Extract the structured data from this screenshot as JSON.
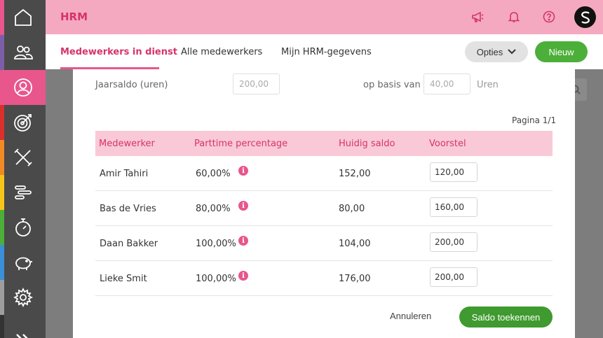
{
  "app": {
    "title": "HRM"
  },
  "tabs": [
    {
      "label": "Medewerkers in dienst",
      "active": true
    },
    {
      "label": "Alle medewerkers",
      "active": false
    },
    {
      "label": "Mijn HRM-gegevens",
      "active": false
    }
  ],
  "toolbar": {
    "opties_label": "Opties",
    "nieuw_label": "Nieuw"
  },
  "sidebar": {
    "items": [
      {
        "name": "home-icon",
        "stripe": "#e8568c"
      },
      {
        "name": "users-icon",
        "stripe": "#7b5ea7"
      },
      {
        "name": "user-icon",
        "stripe": "#e8568c",
        "active": true
      },
      {
        "name": "target-icon",
        "stripe": "#d9302c"
      },
      {
        "name": "tools-icon",
        "stripe": "#f08a24"
      },
      {
        "name": "planning-icon",
        "stripe": "#f5c518"
      },
      {
        "name": "stopwatch-icon",
        "stripe": "#4caf39"
      },
      {
        "name": "piggy-bank-icon",
        "stripe": "#3b8fd9"
      },
      {
        "name": "gear-icon",
        "stripe": "#9e9e9e"
      },
      {
        "name": "expand-icon",
        "stripe": "#333333"
      }
    ]
  },
  "form": {
    "jaarsaldo_label": "Jaarsaldo (uren)",
    "jaarsaldo_value": "200,00",
    "basis_label": "op basis van",
    "basis_value": "40,00",
    "unit_label": "Uren"
  },
  "pagination": {
    "text": "Pagina 1/1"
  },
  "table": {
    "headers": [
      "Medewerker",
      "Parttime percentage",
      "Huidig saldo",
      "Voorstel"
    ],
    "rows": [
      {
        "name": "Amir Tahiri",
        "percentage": "60,00%",
        "saldo": "152,00",
        "voorstel": "120,00"
      },
      {
        "name": "Bas de Vries",
        "percentage": "80,00%",
        "saldo": "80,00",
        "voorstel": "160,00"
      },
      {
        "name": "Daan Bakker",
        "percentage": "100,00%",
        "saldo": "104,00",
        "voorstel": "200,00"
      },
      {
        "name": "Lieke Smit",
        "percentage": "100,00%",
        "saldo": "176,00",
        "voorstel": "200,00"
      }
    ]
  },
  "actions": {
    "cancel_label": "Annuleren",
    "submit_label": "Saldo toekennen"
  },
  "colors": {
    "accent": "#e8568c",
    "topbar": "#f4a9c0",
    "success": "#4caf39"
  }
}
